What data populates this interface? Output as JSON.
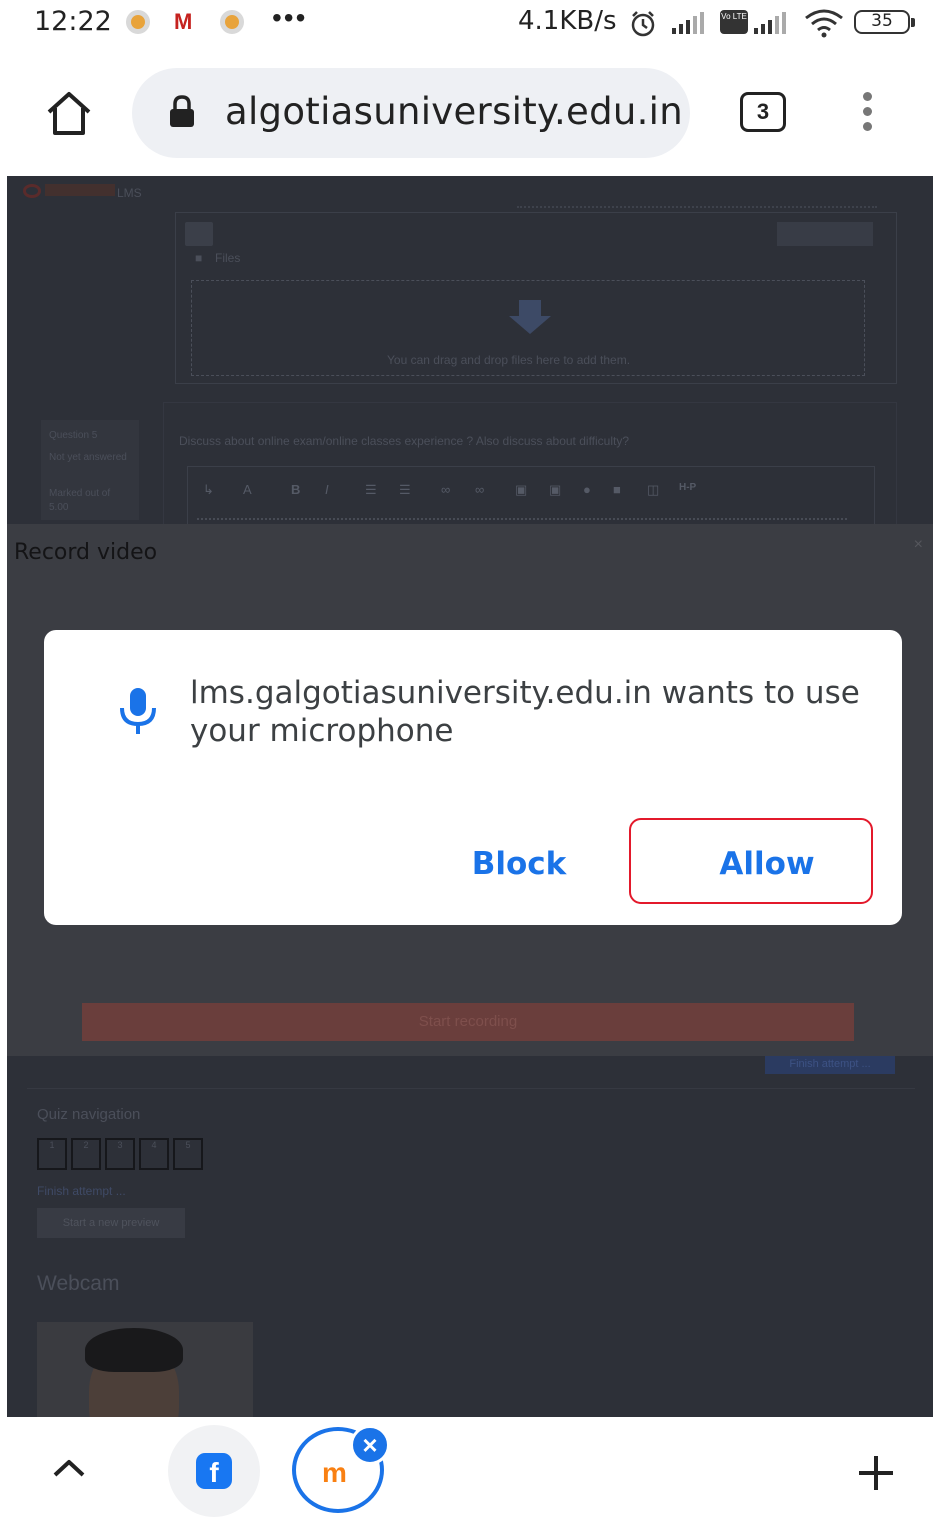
{
  "status_bar": {
    "time": "12:22",
    "more": "•••",
    "net_speed": "4.1KB/s",
    "volte_label": "Vo LTE",
    "battery": "35"
  },
  "browser": {
    "url": "algotiasuniversity.edu.in",
    "tab_count": "3",
    "icons": [
      "home-icon",
      "lock-icon",
      "tab-switcher-icon",
      "overflow-menu-icon"
    ]
  },
  "page": {
    "site_logo_text": "LMS",
    "files_label": "Files",
    "drop_hint": "You can drag and drop files here to add them.",
    "question_info": {
      "question_label": "Question 5",
      "status": "Not yet answered",
      "marked_out_of": "Marked out of",
      "marks": "5.00"
    },
    "question_text": "Discuss about online exam/online classes experience ? Also discuss about difficulty?",
    "finish_button": "Finish attempt ...",
    "quiz_nav_title": "Quiz navigation",
    "quiz_nav_numbers": [
      "1",
      "2",
      "3",
      "4",
      "5"
    ],
    "finish_attempt_link": "Finish attempt ...",
    "new_preview_button": "Start a new preview",
    "webcam_title": "Webcam"
  },
  "record_modal": {
    "title": "Record video",
    "close": "×",
    "start_button": "Start recording"
  },
  "permission_dialog": {
    "message": "lms.galgotiasuniversity.edu.in wants to use your microphone",
    "block_label": "Block",
    "allow_label": "Allow",
    "accent_color": "#1a73e8",
    "highlight_color": "#e3192b"
  },
  "bottom_bar": {
    "icons": [
      "chevron-up-icon",
      "facebook-icon",
      "moodle-icon",
      "close-tab-icon",
      "new-tab-plus-icon"
    ]
  }
}
